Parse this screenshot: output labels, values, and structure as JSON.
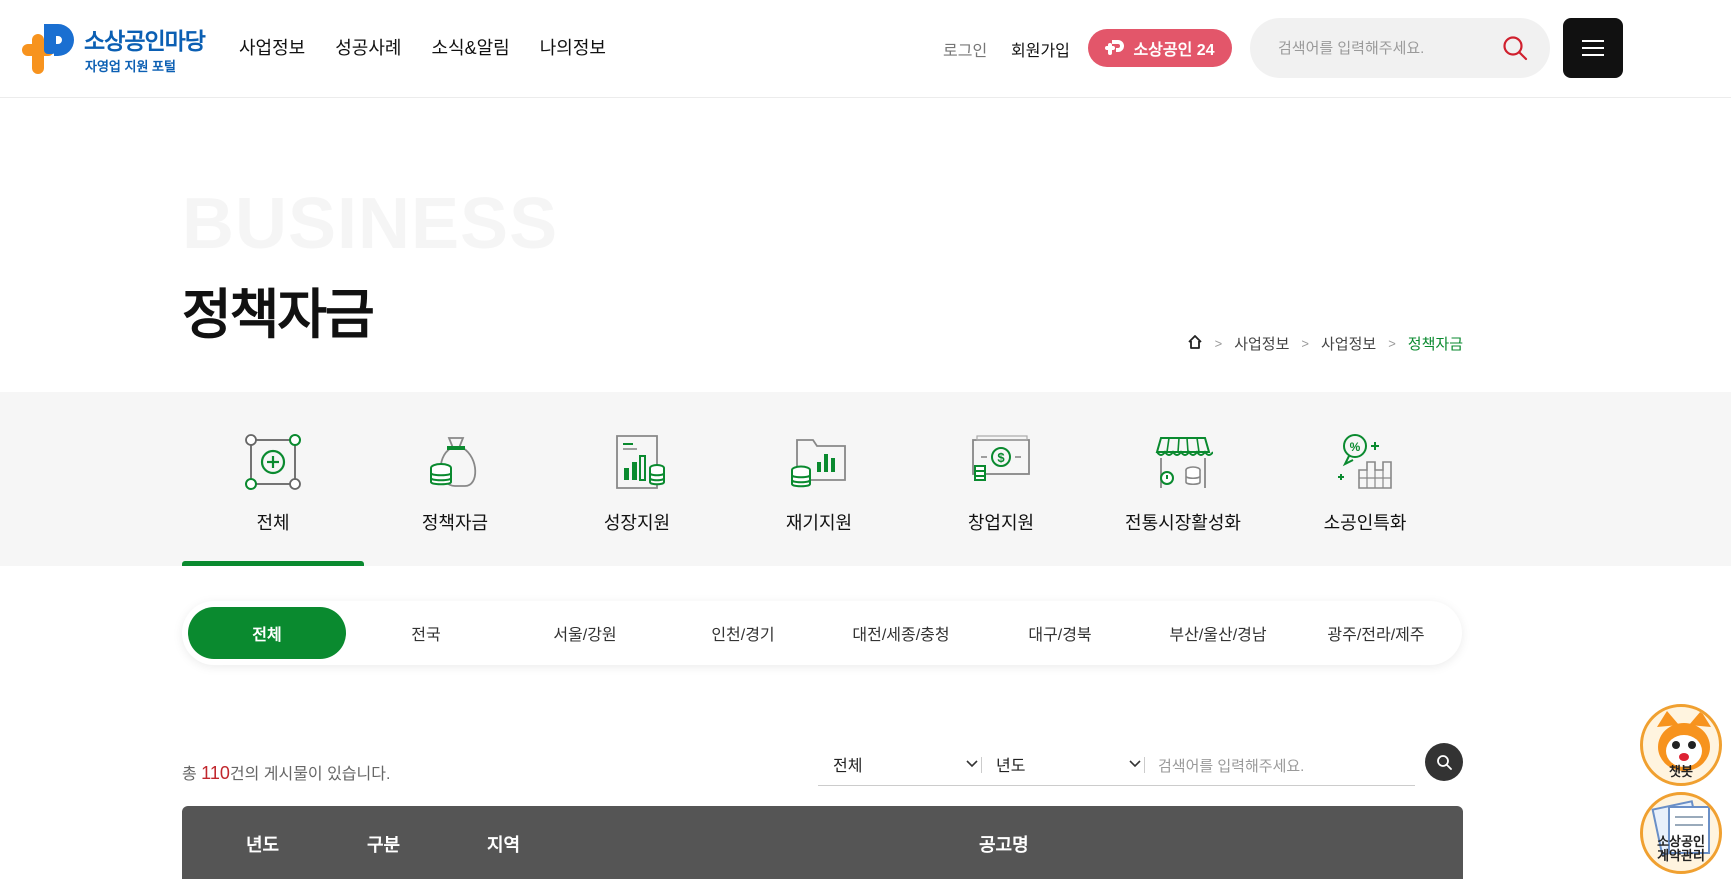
{
  "header": {
    "logo_title": "소상공인마당",
    "logo_sub": "자영업 지원 포털",
    "nav": [
      "사업정보",
      "성공사례",
      "소식&알림",
      "나의정보"
    ],
    "login": "로그인",
    "join": "회원가입",
    "btn24": "소상공인 24",
    "search_placeholder": "검색어를 입력해주세요."
  },
  "hero": {
    "bg_word": "BUSINESS",
    "title": "정책자금",
    "breadcrumb": [
      "사업정보",
      "사업정보",
      "정책자금"
    ]
  },
  "categories": [
    {
      "label": "전체",
      "icon": "all-icon"
    },
    {
      "label": "정책자금",
      "icon": "money-bag-icon"
    },
    {
      "label": "성장지원",
      "icon": "growth-chart-icon"
    },
    {
      "label": "재기지원",
      "icon": "folder-chart-icon"
    },
    {
      "label": "창업지원",
      "icon": "cash-icon"
    },
    {
      "label": "전통시장활성화",
      "icon": "market-stall-icon"
    },
    {
      "label": "소공인특화",
      "icon": "factory-percent-icon"
    }
  ],
  "regions": [
    "전체",
    "전국",
    "서울/강원",
    "인천/경기",
    "대전/세종/충청",
    "대구/경북",
    "부산/울산/경남",
    "광주/전라/제주"
  ],
  "list": {
    "count_prefix": "총 ",
    "count": "110",
    "count_suffix": "건의 게시물이 있습니다.",
    "filter1": "전체",
    "filter2": "년도",
    "search_placeholder": "검색어를 입력해주세요."
  },
  "table": {
    "columns": [
      "년도",
      "구분",
      "지역",
      "공고명"
    ]
  },
  "widgets": {
    "chatbot": "챗봇",
    "contract_line1": "소상공인",
    "contract_line2": "계약관리"
  },
  "colors": {
    "accent": "#0a8a2f",
    "brand": "#0b5fb3",
    "pink": "#e3566a"
  }
}
